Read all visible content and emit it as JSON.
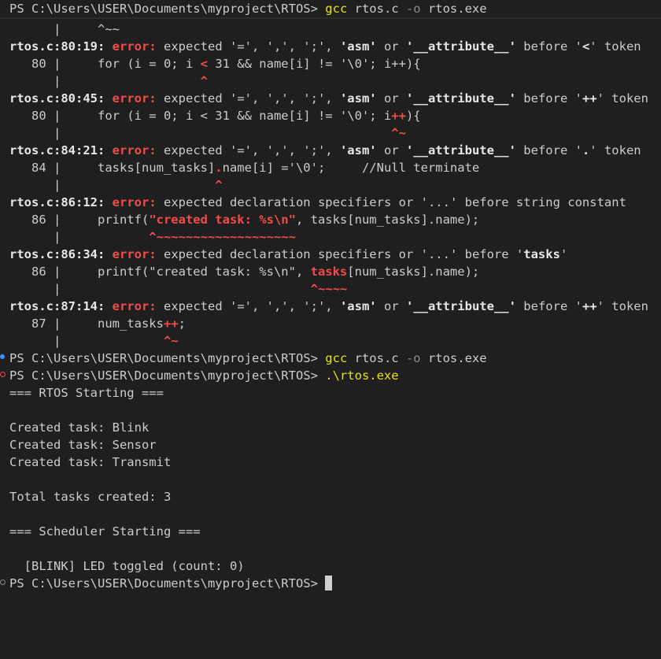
{
  "terminal": {
    "prompt": "PS C:\\Users\\USER\\Documents\\myproject\\RTOS> ",
    "commands": {
      "gcc": "gcc",
      "gcc_args_1": " rtos.c ",
      "gcc_flag": "-o",
      "gcc_args_2": " rtos.exe",
      "run": ".\\rtos.exe"
    },
    "errors": [
      {
        "loc": "rtos.c:80:19:",
        "kind": "error:",
        "msg_pre": " expected '=', ',', ';', ",
        "asm": "'asm'",
        "or": " or ",
        "attr": "'__attribute__'",
        "before": " before '",
        "tok": "<",
        "tail": "' token",
        "gutter": "   80 |",
        "code_pre": "     for (i = 0; i ",
        "code_hl": "<",
        "code_post": " 31 && name[i] != '\\0'; i++){",
        "caret_gutter": "      |",
        "caret": "                   ^"
      },
      {
        "loc": "rtos.c:80:45:",
        "kind": "error:",
        "msg_pre": " expected '=', ',', ';', ",
        "asm": "'asm'",
        "or": " or ",
        "attr": "'__attribute__'",
        "before": " before '",
        "tok": "++",
        "tail": "' token",
        "gutter": "   80 |",
        "code_pre": "     for (i = 0; i < 31 && name[i] != '\\0'; i",
        "code_hl": "++",
        "code_post": "){",
        "caret_gutter": "      |",
        "caret": "                                             ^~"
      },
      {
        "loc": "rtos.c:84:21:",
        "kind": "error:",
        "msg_pre": " expected '=', ',', ';', ",
        "asm": "'asm'",
        "or": " or ",
        "attr": "'__attribute__'",
        "before": " before '",
        "tok": ".",
        "tail": "' token",
        "gutter": "   84 |",
        "code_pre": "     tasks[num_tasks]",
        "code_hl": ".",
        "code_post": "name[i] ='\\0';     //Null terminate",
        "caret_gutter": "      |",
        "caret": "                     ^"
      },
      {
        "loc": "rtos.c:86:12:",
        "kind": "error:",
        "msg_pre": " expected declaration specifiers or '...' before string constant",
        "gutter": "   86 |",
        "code_pre": "     printf(",
        "code_hl": "\"created task: %s\\n\"",
        "code_post": ", tasks[num_tasks].name);",
        "caret_gutter": "      |",
        "caret": "            ^~~~~~~~~~~~~~~~~~~~"
      },
      {
        "loc": "rtos.c:86:34:",
        "kind": "error:",
        "msg_pre": " expected declaration specifiers or '...' before '",
        "tok_bold": "tasks",
        "tail": "'",
        "gutter": "   86 |",
        "code_pre": "     printf(\"created task: %s\\n\", ",
        "code_hl": "tasks",
        "code_post": "[num_tasks].name);",
        "caret_gutter": "      |",
        "caret": "                                  ^~~~~"
      },
      {
        "loc": "rtos.c:87:14:",
        "kind": "error:",
        "msg_pre": " expected '=', ',', ';', ",
        "asm": "'asm'",
        "or": " or ",
        "attr": "'__attribute__'",
        "before": " before '",
        "tok": "++",
        "tail": "' token",
        "gutter": "   87 |",
        "code_pre": "     num_tasks",
        "code_hl": "++",
        "code_post": ";",
        "caret_gutter": "      |",
        "caret": "              ^~"
      }
    ],
    "first_caret": "      |     ^~~",
    "output": {
      "start": "=== RTOS Starting ===",
      "task1": "Created task: Blink",
      "task2": "Created task: Sensor",
      "task3": "Created task: Transmit",
      "total": "Total tasks created: 3",
      "sched": "=== Scheduler Starting ===",
      "blink": "  [BLINK] LED toggled (count: 0)"
    },
    "colors": {
      "background": "#1f1f1f",
      "error": "#f14c4c",
      "command": "#e5e510",
      "info_marker": "#3794ff"
    }
  }
}
